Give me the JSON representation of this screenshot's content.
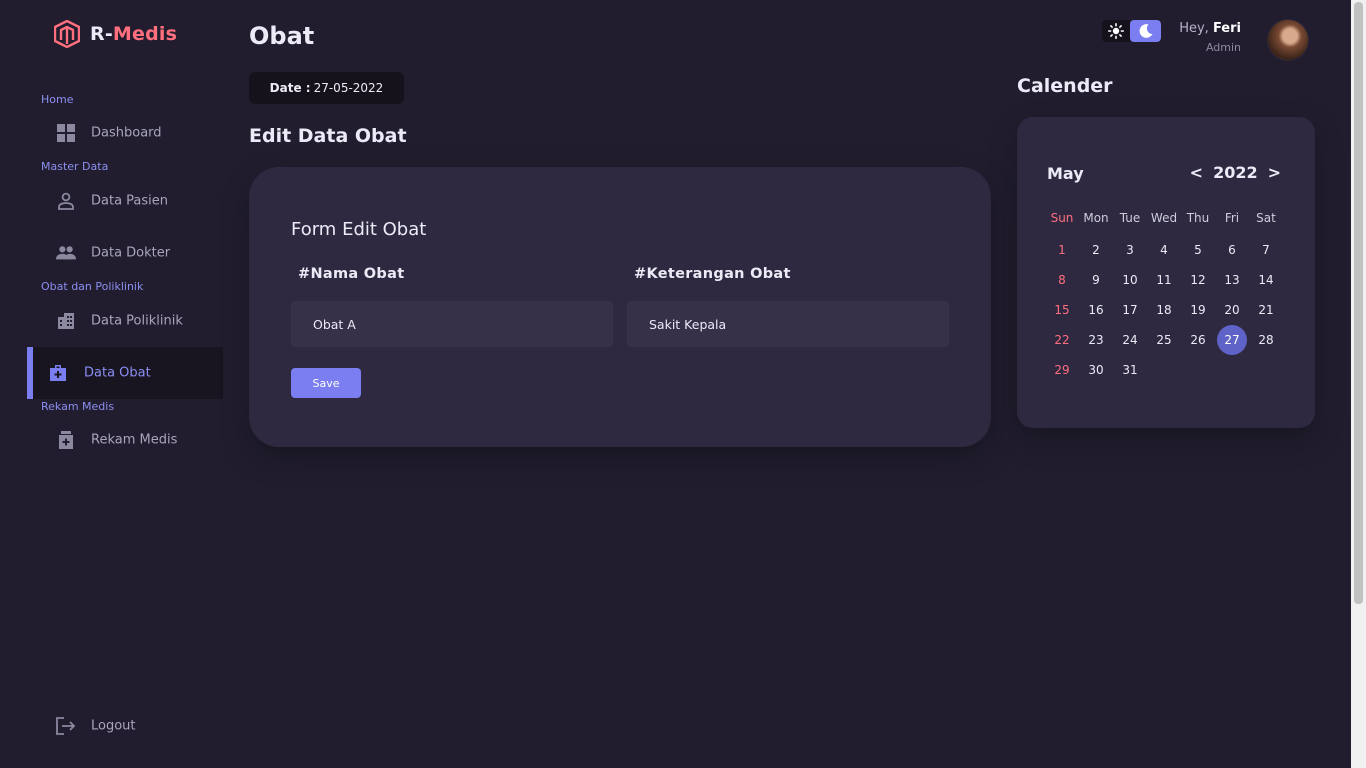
{
  "brand": {
    "prefix": "R-",
    "name": "Medis"
  },
  "sidebar": {
    "sections": [
      {
        "label": "Home"
      },
      {
        "label": "Master Data"
      },
      {
        "label": "Obat dan Poliklinik"
      },
      {
        "label": "Rekam Medis"
      }
    ],
    "items": [
      {
        "label": "Dashboard",
        "icon": "dashboard-icon"
      },
      {
        "label": "Data Pasien",
        "icon": "person-icon"
      },
      {
        "label": "Data Dokter",
        "icon": "people-icon"
      },
      {
        "label": "Data Poliklinik",
        "icon": "building-icon"
      },
      {
        "label": "Data Obat",
        "icon": "medical-bag-icon",
        "active": true
      },
      {
        "label": "Rekam Medis",
        "icon": "medication-icon"
      }
    ],
    "logout": {
      "label": "Logout",
      "icon": "logout-icon"
    }
  },
  "header": {
    "title": "Obat",
    "date_label": "Date :",
    "date_value": "27-05-2022",
    "greeting": "Hey,",
    "user_name": "Feri",
    "user_role": "Admin"
  },
  "main": {
    "section_title": "Edit Data Obat",
    "form": {
      "title": "Form Edit Obat",
      "fields": [
        {
          "label": "#Nama Obat",
          "value": "Obat A"
        },
        {
          "label": "#Keterangan Obat",
          "value": "Sakit Kepala"
        }
      ],
      "save_label": "Save"
    }
  },
  "calendar": {
    "title": "Calender",
    "month": "May",
    "year": "2022",
    "prev": "<",
    "next": ">",
    "weekdays": [
      "Sun",
      "Mon",
      "Tue",
      "Wed",
      "Thu",
      "Fri",
      "Sat"
    ],
    "weeks": [
      [
        "1",
        "2",
        "3",
        "4",
        "5",
        "6",
        "7"
      ],
      [
        "8",
        "9",
        "10",
        "11",
        "12",
        "13",
        "14"
      ],
      [
        "15",
        "16",
        "17",
        "18",
        "19",
        "20",
        "21"
      ],
      [
        "22",
        "23",
        "24",
        "25",
        "26",
        "27",
        "28"
      ],
      [
        "29",
        "30",
        "31",
        "",
        "",
        "",
        ""
      ]
    ],
    "selected": "27"
  },
  "colors": {
    "background": "#211d2e",
    "card": "#2e2940",
    "accent": "#7a7ef0",
    "brand": "#ff6f7d"
  }
}
